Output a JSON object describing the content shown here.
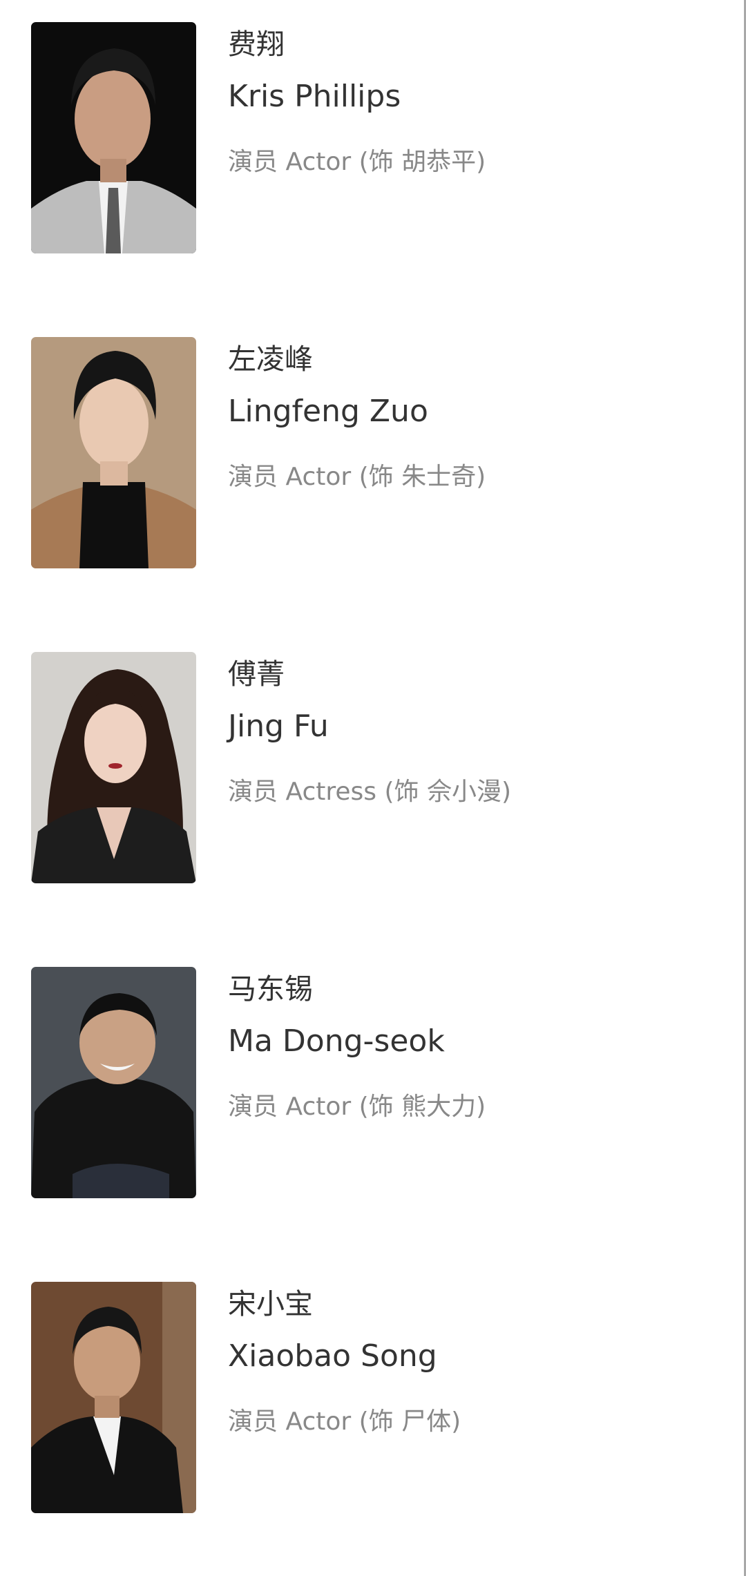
{
  "cast": [
    {
      "name_zh": "费翔",
      "name_en": "Kris Phillips",
      "role": "演员 Actor (饰 胡恭平)",
      "photo_icon": "portrait-photo"
    },
    {
      "name_zh": "左凌峰",
      "name_en": "Lingfeng Zuo",
      "role": "演员 Actor (饰 朱士奇)",
      "photo_icon": "portrait-photo"
    },
    {
      "name_zh": "傅菁",
      "name_en": "Jing Fu",
      "role": "演员 Actress (饰 佘小漫)",
      "photo_icon": "portrait-photo"
    },
    {
      "name_zh": "马东锡",
      "name_en": "Ma Dong-seok",
      "role": "演员 Actor (饰 熊大力)",
      "photo_icon": "portrait-photo"
    },
    {
      "name_zh": "宋小宝",
      "name_en": "Xiaobao Song",
      "role": "演员 Actor (饰 尸体)",
      "photo_icon": "portrait-photo"
    }
  ],
  "colors": {
    "name_text": "#333333",
    "role_text": "#888888",
    "background": "#ffffff"
  }
}
